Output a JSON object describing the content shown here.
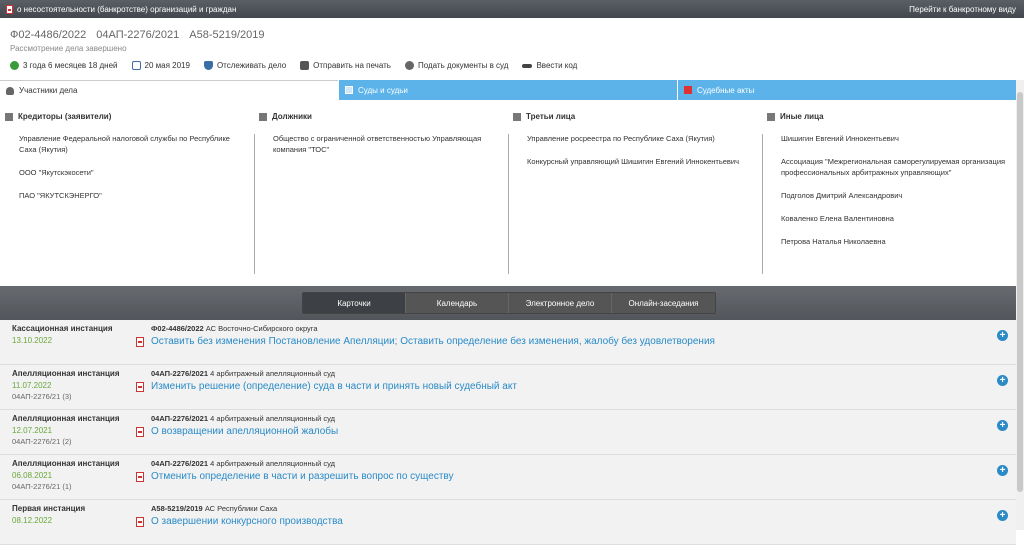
{
  "topbar": {
    "title": "о несостоятельности (банкротстве) организаций и граждан",
    "link": "Перейти к банкротному виду"
  },
  "case": {
    "numbers": [
      "Ф02-4486/2022",
      "04АП-2276/2021",
      "А58-5219/2019"
    ],
    "status": "Рассмотрение дела завершено"
  },
  "toolbar": {
    "duration": "3 года 6 месяцев 18 дней",
    "date": "20 мая 2019",
    "track": "Отслеживать дело",
    "print": "Отправить на печать",
    "submit": "Подать документы в суд",
    "code": "Ввести код"
  },
  "tabs": [
    {
      "label": "Участники дела"
    },
    {
      "label": "Суды и судьи"
    },
    {
      "label": "Судебные акты"
    }
  ],
  "participants": {
    "creditors": {
      "title": "Кредиторы (заявители)",
      "items": [
        "Управление Федеральной налоговой службы по Республике Саха (Якутия)",
        "ООО \"Якутскэкосети\"",
        "ПАО \"ЯКУТСКЭНЕРГО\""
      ]
    },
    "debtors": {
      "title": "Должники",
      "items": [
        "Общество с ограниченной ответственностью Управляющая компания \"ТОС\""
      ]
    },
    "third": {
      "title": "Третьи лица",
      "items": [
        "Управление росреестра по Республике Саха (Якутия)",
        "Конкурсный управляющий Шишигин Евгений Иннокентьевич"
      ]
    },
    "other": {
      "title": "Иные лица",
      "items": [
        "Шишигин Евгений Иннокентьевич",
        "Ассоциация \"Межрегиональная саморегулируемая организация профессиональных арбитражных управляющих\"",
        "Подголов Дмитрий Александрович",
        "Коваленко Елена Валентиновна",
        "Петрова Наталья Николаевна"
      ]
    }
  },
  "views": [
    "Карточки",
    "Календарь",
    "Электронное дело",
    "Онлайн-заседания"
  ],
  "cards": [
    {
      "instance": "Кассационная инстанция",
      "date": "13.10.2022",
      "num": "",
      "case_no": "Ф02-4486/2022",
      "court": "АС Восточно-Сибирского округа",
      "result": "Оставить без изменения Постановление Апелляции; Оставить определение без изменения, жалобу без удовлетворения"
    },
    {
      "instance": "Апелляционная инстанция",
      "date": "11.07.2022",
      "num": "04АП-2276/21 (3)",
      "case_no": "04АП-2276/2021",
      "court": "4 арбитражный апелляционный суд",
      "result": "Изменить решение (определение) суда в части и принять новый судебный акт"
    },
    {
      "instance": "Апелляционная инстанция",
      "date": "12.07.2021",
      "num": "04АП-2276/21 (2)",
      "case_no": "04АП-2276/2021",
      "court": "4 арбитражный апелляционный суд",
      "result": "О возвращении апелляционной жалобы"
    },
    {
      "instance": "Апелляционная инстанция",
      "date": "06.08.2021",
      "num": "04АП-2276/21 (1)",
      "case_no": "04АП-2276/2021",
      "court": "4 арбитражный апелляционный суд",
      "result": "Отменить определение в части и разрешить вопрос по существу"
    },
    {
      "instance": "Первая инстанция",
      "date": "08.12.2022",
      "num": "",
      "case_no": "А58-5219/2019",
      "court": "АС Республики Саха",
      "result": "О завершении конкурсного производства"
    }
  ]
}
